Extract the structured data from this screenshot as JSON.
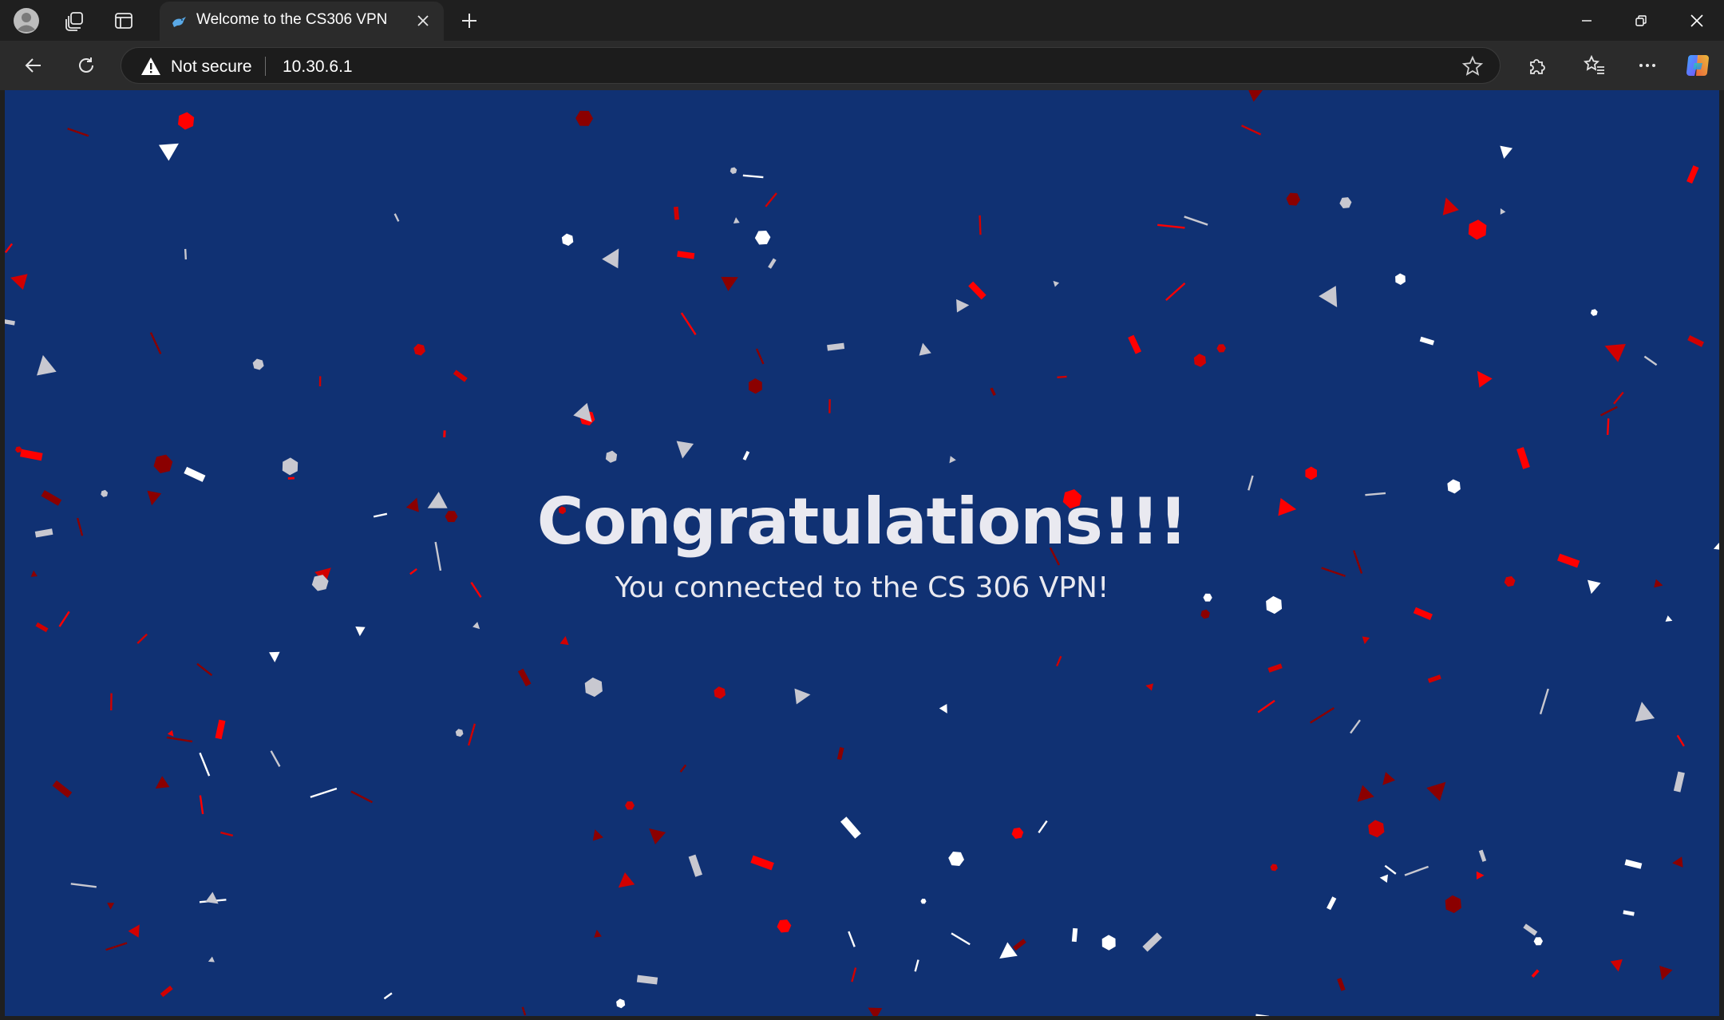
{
  "browser": {
    "tab": {
      "title": "Welcome to the CS306 VPN"
    },
    "address_bar": {
      "security_label": "Not secure",
      "url": "10.30.6.1"
    },
    "icons": {
      "profile": "profile-avatar-icon",
      "workspaces": "workspaces-icon",
      "vertical_tabs": "tab-actions-icon",
      "favicon": "bird-favicon-icon",
      "close_tab": "close-icon",
      "new_tab": "plus-icon",
      "minimize": "minimize-icon",
      "restore": "restore-icon",
      "close_window": "close-icon",
      "back": "arrow-left-icon",
      "refresh": "refresh-icon",
      "warning": "warning-triangle-icon",
      "favorite": "star-icon",
      "extensions": "puzzle-icon",
      "favorites": "favorites-list-icon",
      "more": "ellipsis-icon",
      "copilot": "copilot-icon"
    }
  },
  "page": {
    "headline": "Congratulations!!!",
    "message": "You connected to the CS 306 VPN!",
    "colors": {
      "background": "#103173",
      "text": "#e9e9f0",
      "confetti": [
        "#ffffff",
        "#c8c8d0",
        "#ff0000",
        "#d10000",
        "#8b0000"
      ]
    }
  }
}
